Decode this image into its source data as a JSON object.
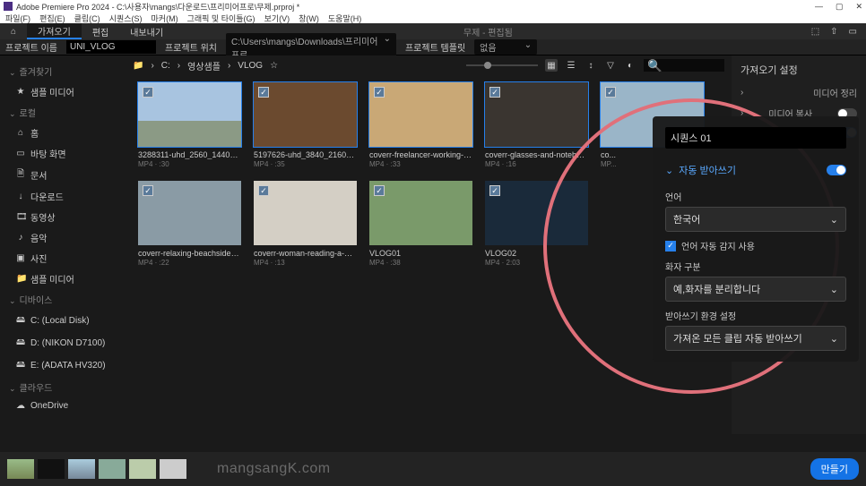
{
  "title": "Adobe Premiere Pro 2024 - C:\\사용자\\mangs\\다운로드\\프리미어프로\\무제.prproj *",
  "menu": [
    "파일(F)",
    "편집(E)",
    "클립(C)",
    "시퀀스(S)",
    "마커(M)",
    "그래픽 및 타이틀(G)",
    "보기(V)",
    "창(W)",
    "도움말(H)"
  ],
  "tabs": {
    "import": "가져오기",
    "edit": "편집",
    "export": "내보내기"
  },
  "center_title": "무제 - 편집됨",
  "proj": {
    "label_name": "프로젝트 이름",
    "name": "UNI_VLOG",
    "label_loc": "프로젝트 위치",
    "loc": "C:\\Users\\mangs\\Downloads\\프리미어프로",
    "label_tmpl": "프로젝트 템플릿",
    "tmpl": "없음"
  },
  "sidebar": {
    "fav": "즐겨찾기",
    "fav_items": [
      {
        "ic": "★",
        "label": "샘플 미디어"
      }
    ],
    "local": "로컬",
    "local_items": [
      {
        "ic": "⌂",
        "label": "홈"
      },
      {
        "ic": "▭",
        "label": "바탕 화면"
      },
      {
        "ic": "🗎",
        "label": "문서"
      },
      {
        "ic": "↓",
        "label": "다운로드"
      },
      {
        "ic": "🎞",
        "label": "동영상"
      },
      {
        "ic": "♪",
        "label": "음악"
      },
      {
        "ic": "▣",
        "label": "사진"
      },
      {
        "ic": "📁",
        "label": "샘플 미디어"
      }
    ],
    "device": "디바이스",
    "device_items": [
      {
        "ic": "🖴",
        "label": "C: (Local Disk)"
      },
      {
        "ic": "🖴",
        "label": "D: (NIKON D7100)"
      },
      {
        "ic": "🖴",
        "label": "E: (ADATA HV320)"
      }
    ],
    "cloud": "클라우드",
    "cloud_items": [
      {
        "ic": "☁",
        "label": "OneDrive"
      }
    ]
  },
  "crumbs": {
    "c": "C:",
    "folder": "영상샘플",
    "sub": "VLOG"
  },
  "clips": [
    {
      "name": "3288311-uhd_2560_1440_30fps",
      "meta": "MP4 · :30",
      "cls": "t1"
    },
    {
      "name": "5197626-uhd_3840_2160_25fps",
      "meta": "MP4 · :35",
      "cls": "t2"
    },
    {
      "name": "coverr-freelancer-working-from-ho...",
      "meta": "MP4 · :33",
      "cls": "t3"
    },
    {
      "name": "coverr-glasses-and-notebooks-on-a...",
      "meta": "MP4 · :16",
      "cls": "t4"
    },
    {
      "name": "co...",
      "meta": "MP...",
      "cls": "t5"
    },
    {
      "name": "coverr-relaxing-beachside-reading-s...",
      "meta": "MP4 · :22",
      "cls": "t6"
    },
    {
      "name": "coverr-woman-reading-a-menu-90...",
      "meta": "MP4 · :13",
      "cls": "t7"
    },
    {
      "name": "VLOG01",
      "meta": "MP4 · :38",
      "cls": "t8"
    },
    {
      "name": "VLOG02",
      "meta": "MP4 · 2:03",
      "cls": "t9"
    }
  ],
  "rightpanel": {
    "title": "가져오기 설정",
    "r1": "미디어 정리",
    "r2": "미디어 복사"
  },
  "overlay": {
    "seq": "시퀀스 01",
    "section": "자동 받아쓰기",
    "lang_lbl": "언어",
    "lang": "한국어",
    "auto_detect": "언어 자동 감지 사용",
    "speaker_lbl": "화자 구분",
    "speaker": "예,화자를 분리합니다",
    "env_lbl": "받아쓰기 환경 설정",
    "env": "가져온 모든 클립 자동 받아쓰기"
  },
  "watermark": "mangsangK.com",
  "create": "만들기"
}
